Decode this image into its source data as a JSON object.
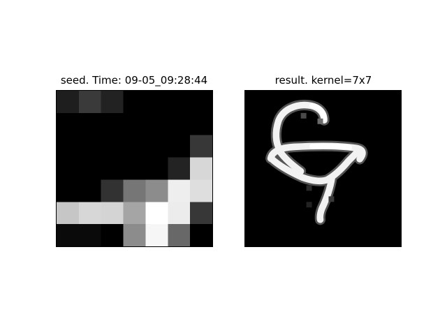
{
  "panels": {
    "left": {
      "title": "seed. Time: 09-05_09:28:44"
    },
    "right": {
      "title": "result. kernel=7x7"
    }
  },
  "seed_grid": [
    [
      30,
      58,
      34,
      0,
      0,
      0,
      0
    ],
    [
      0,
      0,
      0,
      0,
      0,
      0,
      0
    ],
    [
      0,
      0,
      0,
      0,
      0,
      0,
      55
    ],
    [
      0,
      0,
      0,
      0,
      0,
      35,
      215
    ],
    [
      0,
      0,
      50,
      118,
      140,
      238,
      222
    ],
    [
      198,
      215,
      212,
      165,
      255,
      236,
      55
    ],
    [
      10,
      10,
      0,
      140,
      246,
      104,
      0
    ]
  ]
}
